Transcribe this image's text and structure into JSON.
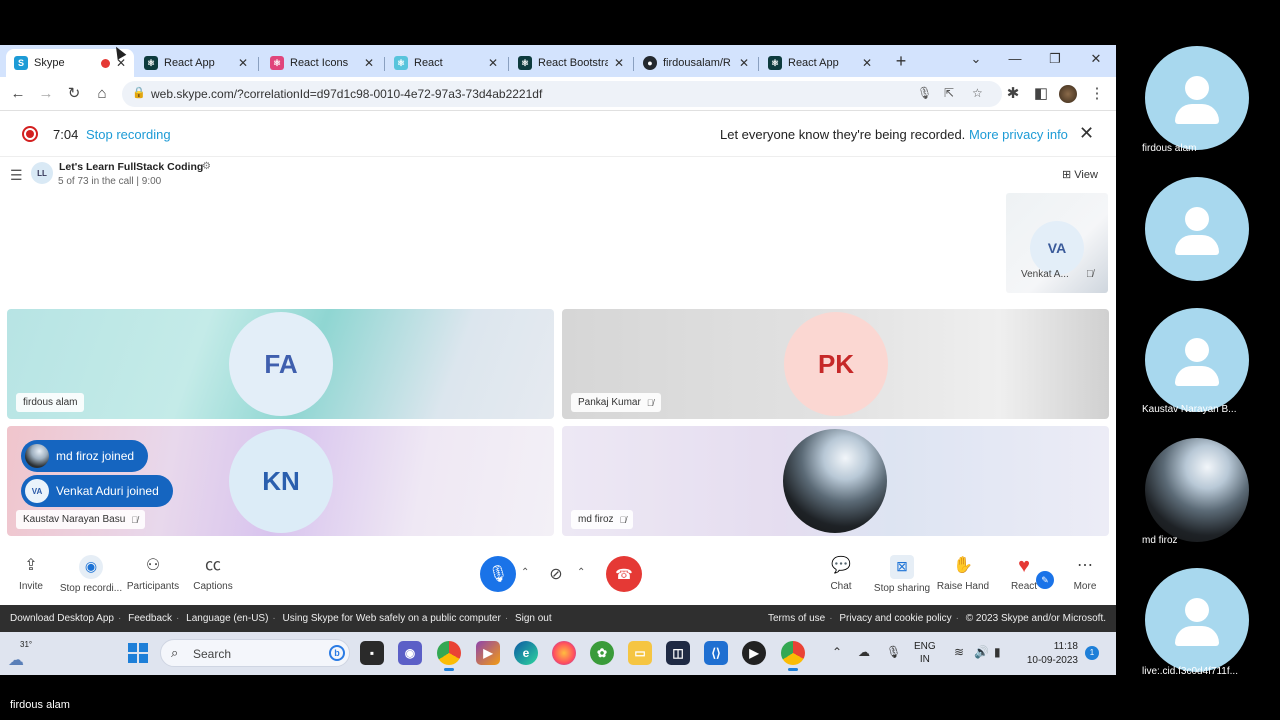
{
  "browser": {
    "tabs": [
      {
        "title": "Skype",
        "favicon": "skype-icon",
        "color": "#1d9bd6",
        "active": true,
        "recording": true
      },
      {
        "title": "React App",
        "favicon": "react-app-icon",
        "color": "#0d3b3e"
      },
      {
        "title": "React Icons",
        "favicon": "react-icons-icon",
        "color": "#e0457b"
      },
      {
        "title": "React",
        "favicon": "react-icon",
        "color": "#58c4dc"
      },
      {
        "title": "React Bootstra",
        "favicon": "react-bootstrap-icon",
        "color": "#0d3b3e"
      },
      {
        "title": "firdousalam/R",
        "favicon": "github-icon",
        "color": "#24292f"
      },
      {
        "title": "React App",
        "favicon": "react-app-icon",
        "color": "#0d3b3e"
      }
    ],
    "new_tab": "+",
    "url": "web.skype.com/?correlationId=d97d1c98-0010-4e72-97a3-73d4ab2221df"
  },
  "recording": {
    "time": "7:04",
    "stop_label": "Stop recording",
    "message": "Let everyone know they're being recorded.",
    "privacy_link": "More privacy info"
  },
  "call": {
    "group_initials": "LL",
    "group_name": "Let's Learn FullStack Coding",
    "status": "5 of 73 in the call | 9:00",
    "view_label": "View"
  },
  "thumbnail": {
    "initials": "VA",
    "name": "Venkat A..."
  },
  "tiles": [
    {
      "initials": "FA",
      "name": "firdous alam",
      "muted": false,
      "color": "#3f5fae",
      "bg": "#e3eef8"
    },
    {
      "initials": "PK",
      "name": "Pankaj Kumar",
      "muted": true,
      "color": "#c62828",
      "bg": "#fbd7d2"
    },
    {
      "initials": "KN",
      "name": "Kaustav Narayan Basu",
      "muted": true,
      "color": "#2a5fae",
      "bg": "#dcecf7"
    },
    {
      "initials": "",
      "name": "md firoz",
      "muted": true,
      "photo": true
    }
  ],
  "notifications": [
    {
      "text": "md firoz joined",
      "avatar": "photo"
    },
    {
      "text": "Venkat Aduri joined",
      "avatar": "VA"
    }
  ],
  "controls": {
    "left": [
      {
        "label": "Invite",
        "icon": "share-icon"
      },
      {
        "label": "Stop recordi...",
        "icon": "record-icon"
      },
      {
        "label": "Participants",
        "icon": "participants-icon"
      },
      {
        "label": "Captions",
        "icon": "captions-icon"
      }
    ],
    "right": [
      {
        "label": "Chat",
        "icon": "chat-icon"
      },
      {
        "label": "Stop sharing",
        "icon": "stop-sharing-icon"
      },
      {
        "label": "Raise Hand",
        "icon": "raise-hand-icon"
      },
      {
        "label": "React",
        "icon": "heart-icon"
      },
      {
        "label": "More",
        "icon": "more-icon"
      }
    ]
  },
  "footer": {
    "left": [
      "Download Desktop App",
      "Feedback",
      "Language (en-US)",
      "Using Skype for Web safely on a public computer",
      "Sign out"
    ],
    "right": [
      "Terms of use",
      "Privacy and cookie policy",
      "© 2023 Skype and/or Microsoft."
    ]
  },
  "taskbar": {
    "temperature": "31°",
    "search_placeholder": "Search",
    "lang_top": "ENG",
    "lang_bottom": "IN",
    "time": "11:18",
    "date": "10-09-2023",
    "notification_count": "1"
  },
  "side_participants": [
    {
      "name": "firdous alam",
      "photo": false
    },
    {
      "name": "",
      "photo": false
    },
    {
      "name": "Kaustav Narayan B...",
      "photo": false
    },
    {
      "name": "md firoz",
      "photo": true
    },
    {
      "name": "live:.cid.f3c0d4f711f...",
      "photo": false
    }
  ],
  "presenter_name": "firdous alam"
}
